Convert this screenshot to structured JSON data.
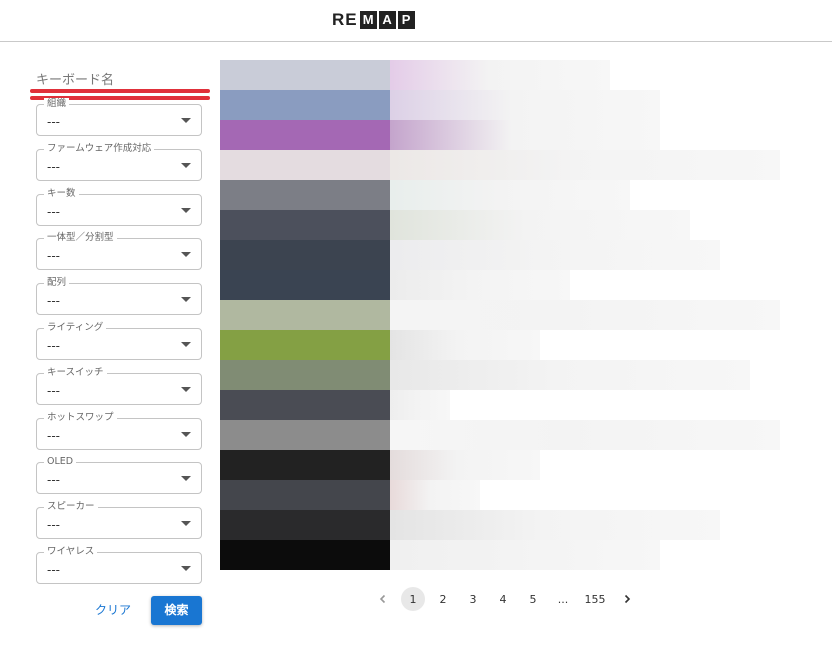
{
  "header": {
    "logo_plain": "RE",
    "logo_boxed": [
      "M",
      "A",
      "P"
    ]
  },
  "sidebar": {
    "keyboard_name_label": "キーボード名",
    "filters": [
      {
        "label": "組織",
        "value": "---"
      },
      {
        "label": "ファームウェア作成対応",
        "value": "---"
      },
      {
        "label": "キー数",
        "value": "---"
      },
      {
        "label": "一体型／分割型",
        "value": "---"
      },
      {
        "label": "配列",
        "value": "---"
      },
      {
        "label": "ライティング",
        "value": "---"
      },
      {
        "label": "キースイッチ",
        "value": "---"
      },
      {
        "label": "ホットスワップ",
        "value": "---"
      },
      {
        "label": "OLED",
        "value": "---"
      },
      {
        "label": "スピーカー",
        "value": "---"
      },
      {
        "label": "ワイヤレス",
        "value": "---"
      }
    ],
    "clear_label": "クリア",
    "search_label": "検索"
  },
  "results": {
    "rows": [
      {
        "thumb": "#c9ccd8",
        "accent": "#e4cce8"
      },
      {
        "thumb": "#8a9cc0",
        "accent": "#dcd0e6"
      },
      {
        "thumb": "#a468b4",
        "accent": "#c4a4cc"
      },
      {
        "thumb": "#e4dce0",
        "accent": "#ece8e6"
      },
      {
        "thumb": "#7c7e86",
        "accent": "#e8eeec"
      },
      {
        "thumb": "#4c505c",
        "accent": "#e0e4dc"
      },
      {
        "thumb": "#3c4450",
        "accent": "#ececee"
      },
      {
        "thumb": "#3a4452",
        "accent": "#ececec"
      },
      {
        "thumb": "#b0b8a0",
        "accent": "#f4f4f4"
      },
      {
        "thumb": "#84a044",
        "accent": "#e4e4e4"
      },
      {
        "thumb": "#808c74",
        "accent": "#e8e8e8"
      },
      {
        "thumb": "#4a4c54",
        "accent": "#eeeeee"
      },
      {
        "thumb": "#8c8c8c",
        "accent": "#f6f6f6"
      },
      {
        "thumb": "#222222",
        "accent": "#e4dcdc"
      },
      {
        "thumb": "#44464c",
        "accent": "#e8dada"
      },
      {
        "thumb": "#2a2a2c",
        "accent": "#e4e4e4"
      },
      {
        "thumb": "#0c0c0c",
        "accent": "#f0f0f0"
      }
    ]
  },
  "pagination": {
    "prev_icon": "chevron-left-icon",
    "pages": [
      "1",
      "2",
      "3",
      "4",
      "5",
      "...",
      "155"
    ],
    "current": "1",
    "next_icon": "chevron-right-icon"
  },
  "colors": {
    "accent": "#1976d2",
    "underline": "#e0303a"
  }
}
